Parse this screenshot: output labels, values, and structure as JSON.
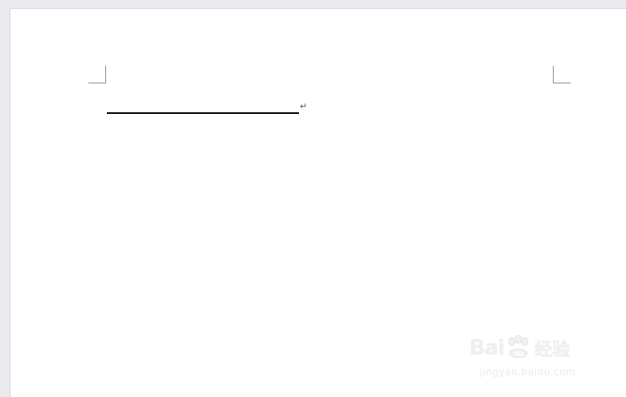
{
  "document": {
    "line_end_mark": "↵"
  },
  "watermark": {
    "brand_before": "Bai",
    "brand_after": "经验",
    "brand_du": "du",
    "url": "jingyan.baidu.com"
  },
  "icons": {
    "paw": "paw-icon",
    "line_end": "paragraph-mark-icon"
  },
  "colors": {
    "workspace": "#ece9ef",
    "page": "#ffffff",
    "underline": "#000000",
    "margin_mark": "#8f8f8f"
  }
}
